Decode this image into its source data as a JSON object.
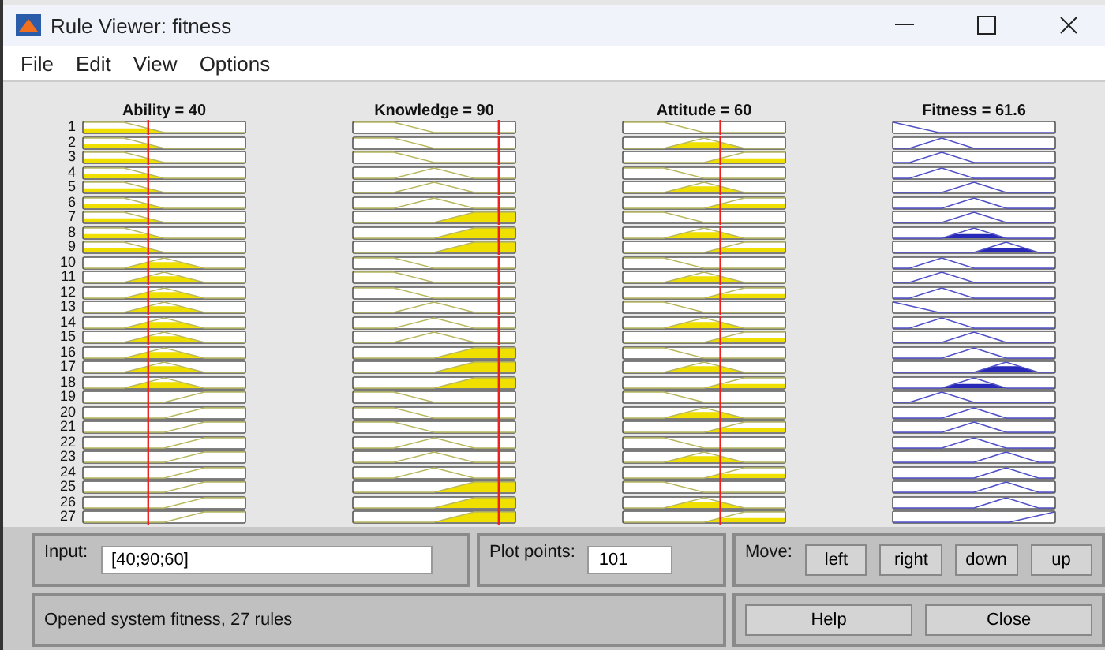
{
  "window": {
    "title": "Rule Viewer: fitness"
  },
  "menu": [
    {
      "label": "File"
    },
    {
      "label": "Edit"
    },
    {
      "label": "View"
    },
    {
      "label": "Options"
    }
  ],
  "inputs": [
    {
      "title": "Ability = 40",
      "level": 0.4
    },
    {
      "title": "Knowledge = 90",
      "level": 0.9
    },
    {
      "title": "Attitude = 60",
      "level": 0.6
    }
  ],
  "output": {
    "title": "Fitness = 61.6"
  },
  "rules": [
    {
      "number": "1",
      "terms": [
        {
          "kind": "low"
        },
        {
          "kind": "low"
        },
        {
          "kind": "low"
        },
        {
          "kind": "vlow"
        }
      ]
    },
    {
      "number": "2",
      "terms": [
        {
          "kind": "low"
        },
        {
          "kind": "low"
        },
        {
          "kind": "mid"
        },
        {
          "kind": "low"
        }
      ]
    },
    {
      "number": "3",
      "terms": [
        {
          "kind": "low"
        },
        {
          "kind": "low"
        },
        {
          "kind": "high"
        },
        {
          "kind": "low"
        }
      ]
    },
    {
      "number": "4",
      "terms": [
        {
          "kind": "low"
        },
        {
          "kind": "mid"
        },
        {
          "kind": "low"
        },
        {
          "kind": "low"
        }
      ]
    },
    {
      "number": "5",
      "terms": [
        {
          "kind": "low"
        },
        {
          "kind": "mid"
        },
        {
          "kind": "mid"
        },
        {
          "kind": "med"
        }
      ]
    },
    {
      "number": "6",
      "terms": [
        {
          "kind": "low"
        },
        {
          "kind": "mid"
        },
        {
          "kind": "high"
        },
        {
          "kind": "med"
        }
      ]
    },
    {
      "number": "7",
      "terms": [
        {
          "kind": "low"
        },
        {
          "kind": "high"
        },
        {
          "kind": "low"
        },
        {
          "kind": "med"
        }
      ]
    },
    {
      "number": "8",
      "terms": [
        {
          "kind": "low"
        },
        {
          "kind": "high"
        },
        {
          "kind": "mid"
        },
        {
          "kind": "med"
        }
      ]
    },
    {
      "number": "9",
      "terms": [
        {
          "kind": "low"
        },
        {
          "kind": "high"
        },
        {
          "kind": "high"
        },
        {
          "kind": "high"
        }
      ]
    },
    {
      "number": "10",
      "terms": [
        {
          "kind": "mid"
        },
        {
          "kind": "low"
        },
        {
          "kind": "low"
        },
        {
          "kind": "low"
        }
      ]
    },
    {
      "number": "11",
      "terms": [
        {
          "kind": "mid"
        },
        {
          "kind": "low"
        },
        {
          "kind": "mid"
        },
        {
          "kind": "low"
        }
      ]
    },
    {
      "number": "12",
      "terms": [
        {
          "kind": "mid"
        },
        {
          "kind": "low"
        },
        {
          "kind": "high"
        },
        {
          "kind": "low"
        }
      ]
    },
    {
      "number": "13",
      "terms": [
        {
          "kind": "mid"
        },
        {
          "kind": "mid"
        },
        {
          "kind": "low"
        },
        {
          "kind": "vlow"
        }
      ]
    },
    {
      "number": "14",
      "terms": [
        {
          "kind": "mid"
        },
        {
          "kind": "mid"
        },
        {
          "kind": "mid"
        },
        {
          "kind": "low"
        }
      ]
    },
    {
      "number": "15",
      "terms": [
        {
          "kind": "mid"
        },
        {
          "kind": "mid"
        },
        {
          "kind": "high"
        },
        {
          "kind": "med"
        }
      ]
    },
    {
      "number": "16",
      "terms": [
        {
          "kind": "mid"
        },
        {
          "kind": "high"
        },
        {
          "kind": "low"
        },
        {
          "kind": "med"
        }
      ]
    },
    {
      "number": "17",
      "terms": [
        {
          "kind": "mid"
        },
        {
          "kind": "high"
        },
        {
          "kind": "mid"
        },
        {
          "kind": "high"
        }
      ]
    },
    {
      "number": "18",
      "terms": [
        {
          "kind": "mid"
        },
        {
          "kind": "high"
        },
        {
          "kind": "high"
        },
        {
          "kind": "med"
        }
      ]
    },
    {
      "number": "19",
      "terms": [
        {
          "kind": "high"
        },
        {
          "kind": "low"
        },
        {
          "kind": "low"
        },
        {
          "kind": "low"
        }
      ]
    },
    {
      "number": "20",
      "terms": [
        {
          "kind": "high"
        },
        {
          "kind": "low"
        },
        {
          "kind": "mid"
        },
        {
          "kind": "med"
        }
      ]
    },
    {
      "number": "21",
      "terms": [
        {
          "kind": "high"
        },
        {
          "kind": "low"
        },
        {
          "kind": "high"
        },
        {
          "kind": "med"
        }
      ]
    },
    {
      "number": "22",
      "terms": [
        {
          "kind": "high"
        },
        {
          "kind": "mid"
        },
        {
          "kind": "low"
        },
        {
          "kind": "med"
        }
      ]
    },
    {
      "number": "23",
      "terms": [
        {
          "kind": "high"
        },
        {
          "kind": "mid"
        },
        {
          "kind": "mid"
        },
        {
          "kind": "high"
        }
      ]
    },
    {
      "number": "24",
      "terms": [
        {
          "kind": "high"
        },
        {
          "kind": "mid"
        },
        {
          "kind": "high"
        },
        {
          "kind": "high"
        }
      ]
    },
    {
      "number": "25",
      "terms": [
        {
          "kind": "high"
        },
        {
          "kind": "high"
        },
        {
          "kind": "low"
        },
        {
          "kind": "high"
        }
      ]
    },
    {
      "number": "26",
      "terms": [
        {
          "kind": "high"
        },
        {
          "kind": "high"
        },
        {
          "kind": "mid"
        },
        {
          "kind": "high"
        }
      ]
    },
    {
      "number": "27",
      "terms": [
        {
          "kind": "high"
        },
        {
          "kind": "high"
        },
        {
          "kind": "high"
        },
        {
          "kind": "vhigh"
        }
      ]
    }
  ],
  "input_field": {
    "label": "Input:",
    "value": "[40;90;60]"
  },
  "plot_points": {
    "label": "Plot points:",
    "value": "101"
  },
  "move": {
    "label": "Move:",
    "buttons": [
      {
        "label": "left"
      },
      {
        "label": "right"
      },
      {
        "label": "down"
      },
      {
        "label": "up"
      }
    ]
  },
  "status": "Opened system fitness, 27 rules",
  "actions": [
    {
      "label": "Help"
    },
    {
      "label": "Close"
    }
  ]
}
